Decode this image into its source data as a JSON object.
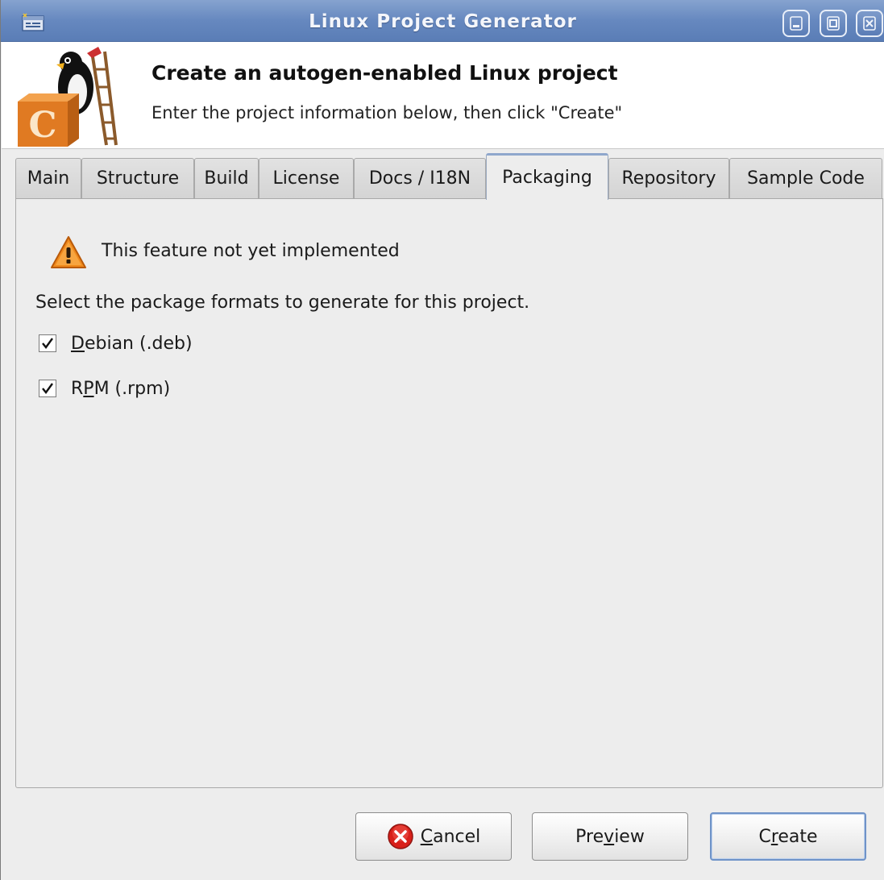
{
  "window": {
    "title": "Linux Project Generator",
    "app_icon": "app-icon",
    "controls": {
      "minimize_icon": "minimize-icon",
      "maximize_icon": "maximize-icon",
      "close_icon": "close-icon"
    }
  },
  "banner": {
    "logo": "tux-with-c-block-logo",
    "logo_text": "C",
    "heading": "Create an autogen-enabled Linux project",
    "subtitle": "Enter the project information below, then click \"Create\""
  },
  "tabs": [
    {
      "label": "Main",
      "active": false
    },
    {
      "label": "Structure",
      "active": false
    },
    {
      "label": "Build",
      "active": false
    },
    {
      "label": "License",
      "active": false
    },
    {
      "label": "Docs / I18N",
      "active": false
    },
    {
      "label": "Packaging",
      "active": true
    },
    {
      "label": "Repository",
      "active": false
    },
    {
      "label": "Sample Code",
      "active": false
    }
  ],
  "packaging": {
    "warning_icon": "warning-icon",
    "warning_text": "This feature not yet implemented",
    "instruction": "Select the package formats to generate for this project.",
    "options": [
      {
        "label_mnemonic": "D",
        "label_rest": "ebian (.deb)",
        "checked": true
      },
      {
        "label_prefix": "R",
        "label_mnemonic": "P",
        "label_rest": "M (.rpm)",
        "checked": true
      }
    ]
  },
  "buttons": {
    "cancel": {
      "icon": "cancel-icon",
      "mnemonic": "C",
      "rest": "ancel"
    },
    "preview": {
      "prefix": "Pre",
      "mnemonic": "v",
      "rest": "iew"
    },
    "create": {
      "prefix": "C",
      "mnemonic": "r",
      "rest": "eate"
    }
  },
  "colors": {
    "titlebar": "#6688bf",
    "window_bg": "#ededed",
    "warning": "#f08a1c",
    "cancel_red": "#d8201a",
    "default_button_border": "#6f93c8"
  }
}
